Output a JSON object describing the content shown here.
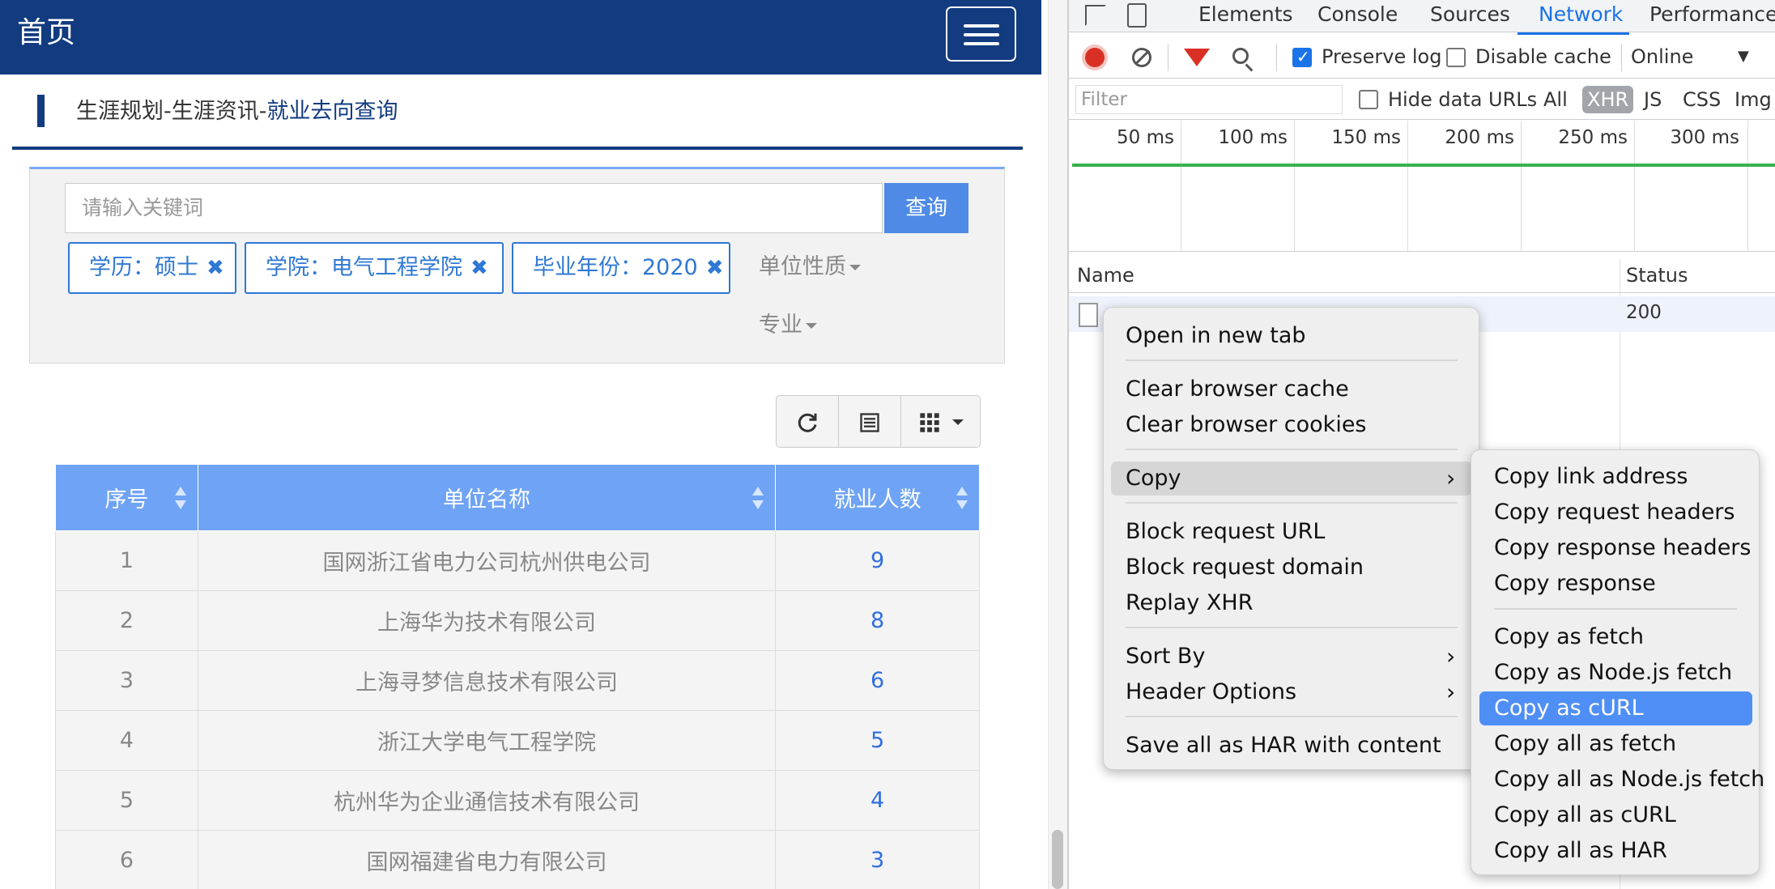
{
  "page": {
    "title": "首页",
    "breadcrumb": {
      "prefix": "生涯规划-生涯资讯-",
      "current": "就业去向查询"
    },
    "search": {
      "placeholder": "请输入关键词",
      "button": "查询"
    },
    "tags": [
      {
        "label": "学历：硕士"
      },
      {
        "label": "学院：电气工程学院"
      },
      {
        "label": "毕业年份：2020"
      }
    ],
    "tag_close_icon": "✖",
    "dropdowns": {
      "unit_nature": "单位性质",
      "major": "专业"
    },
    "table": {
      "headers": [
        "序号",
        "单位名称",
        "就业人数"
      ],
      "rows": [
        [
          "1",
          "国网浙江省电力公司杭州供电公司",
          "9"
        ],
        [
          "2",
          "上海华为技术有限公司",
          "8"
        ],
        [
          "3",
          "上海寻梦信息技术有限公司",
          "6"
        ],
        [
          "4",
          "浙江大学电气工程学院",
          "5"
        ],
        [
          "5",
          "杭州华为企业通信技术有限公司",
          "4"
        ],
        [
          "6",
          "国网福建省电力有限公司",
          "3"
        ]
      ]
    }
  },
  "devtools": {
    "tabs": [
      "Elements",
      "Console",
      "Sources",
      "Network",
      "Performance"
    ],
    "active_tab": "Network",
    "toolbar": {
      "preserve_log": "Preserve log",
      "disable_cache": "Disable cache",
      "throttle": "Online"
    },
    "filter": {
      "placeholder": "Filter",
      "hide_data_urls": "Hide data URLs",
      "types": [
        "All",
        "XHR",
        "JS",
        "CSS",
        "Img"
      ]
    },
    "timeline_labels": [
      "50 ms",
      "100 ms",
      "150 ms",
      "200 ms",
      "250 ms",
      "300 ms"
    ],
    "columns": {
      "name": "Name",
      "status": "Status"
    },
    "request": {
      "status": "200"
    }
  },
  "context_menu": {
    "items": [
      "Open in new tab",
      "Clear browser cache",
      "Clear browser cookies",
      "Copy",
      "Block request URL",
      "Block request domain",
      "Replay XHR",
      "Sort By",
      "Header Options",
      "Save all as HAR with content"
    ],
    "submenu_arrow": "›"
  },
  "copy_submenu": {
    "items": [
      "Copy link address",
      "Copy request headers",
      "Copy response headers",
      "Copy response",
      "Copy as fetch",
      "Copy as Node.js fetch",
      "Copy as cURL",
      "Copy all as fetch",
      "Copy all as Node.js fetch",
      "Copy all as cURL",
      "Copy all as HAR"
    ],
    "highlighted": "Copy as cURL"
  },
  "colors": {
    "header": "#123b80",
    "accent": "#4f8be6",
    "table_header": "#6fa3f5",
    "menu_highlight": "#4f8ff5"
  }
}
